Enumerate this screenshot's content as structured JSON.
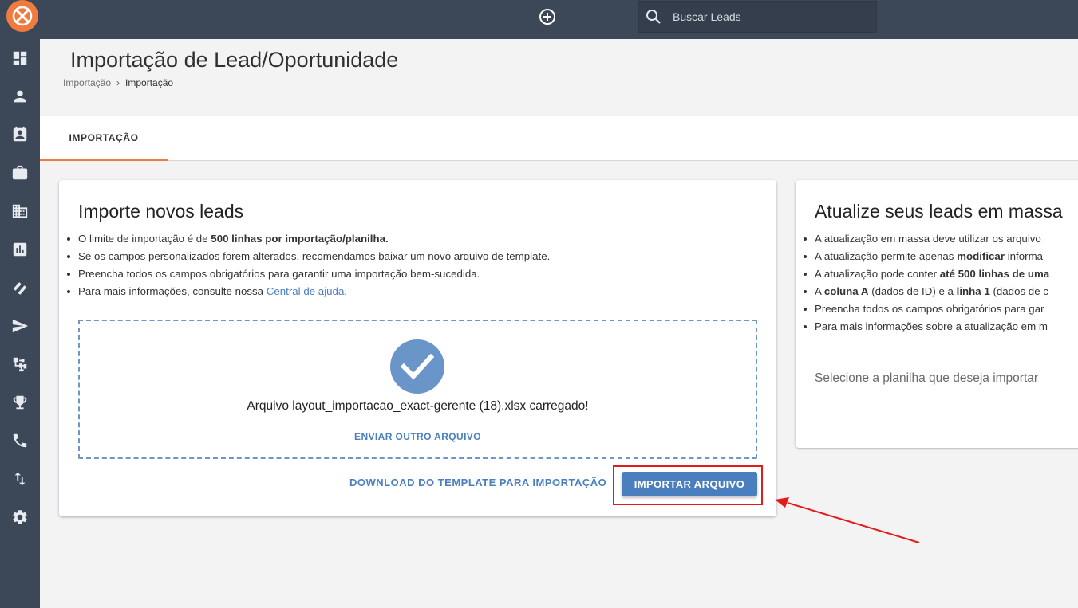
{
  "topbar": {
    "search_placeholder": "Buscar Leads"
  },
  "icons": {
    "logo": "exact-sales-logo-icon",
    "add": "add-circle-icon",
    "search": "search-icon"
  },
  "sidebar": {
    "items": [
      {
        "name": "dashboard-icon"
      },
      {
        "name": "person-icon"
      },
      {
        "name": "contact-card-icon"
      },
      {
        "name": "briefcase-icon"
      },
      {
        "name": "building-icon"
      },
      {
        "name": "bar-chart-icon"
      },
      {
        "name": "tags-icon"
      },
      {
        "name": "send-icon"
      },
      {
        "name": "hierarchy-icon"
      },
      {
        "name": "trophy-icon"
      },
      {
        "name": "phone-icon"
      },
      {
        "name": "sync-arrows-icon"
      },
      {
        "name": "settings-gear-icon"
      }
    ]
  },
  "header": {
    "title": "Importação de Lead/Oportunidade",
    "breadcrumb": {
      "parent": "Importação",
      "current": "Importação"
    }
  },
  "tabs": [
    {
      "label": "IMPORTAÇÃO",
      "active": true
    }
  ],
  "import_card": {
    "title": "Importe novos leads",
    "bullets": {
      "b1_prefix": "O limite de importação é de ",
      "b1_bold": "500 linhas por importação/planilha.",
      "b2": "Se os campos personalizados forem alterados, recomendamos baixar um novo arquivo de template.",
      "b3": "Preencha todos os campos obrigatórios para garantir uma importação bem-sucedida.",
      "b4_prefix": "Para mais informações, consulte nossa ",
      "b4_link": "Central de ajuda",
      "b4_suffix": "."
    },
    "dropzone": {
      "message": "Arquivo layout_importacao_exact-gerente (18).xlsx carregado!",
      "send_other": "ENVIAR OUTRO ARQUIVO"
    },
    "download_template": "DOWNLOAD DO TEMPLATE PARA IMPORTAÇÃO",
    "import_button": "IMPORTAR ARQUIVO"
  },
  "update_card": {
    "title": "Atualize seus leads em massa",
    "bullets": {
      "b1": "A atualização em massa deve utilizar os arquivo",
      "b2_prefix": "A atualização permite apenas ",
      "b2_bold": "modificar",
      "b2_suffix": " informa",
      "b3_prefix": "A atualização pode conter ",
      "b3_bold": "até 500 linhas de uma",
      "b4_a": "A ",
      "b4_bold1": "coluna A",
      "b4_b": " (dados de ID) e a ",
      "b4_bold2": "linha 1",
      "b4_c": " (dados de c",
      "b5": "Preencha todos os campos obrigatórios para gar",
      "b6": "Para mais informações sobre a atualização em m"
    },
    "select_placeholder": "Selecione a planilha que deseja importar"
  },
  "colors": {
    "sidebar_bg": "#3c4758",
    "accent_orange": "#f07b3f",
    "primary_blue": "#4a7fbf",
    "highlight_red": "#e31b1b"
  }
}
